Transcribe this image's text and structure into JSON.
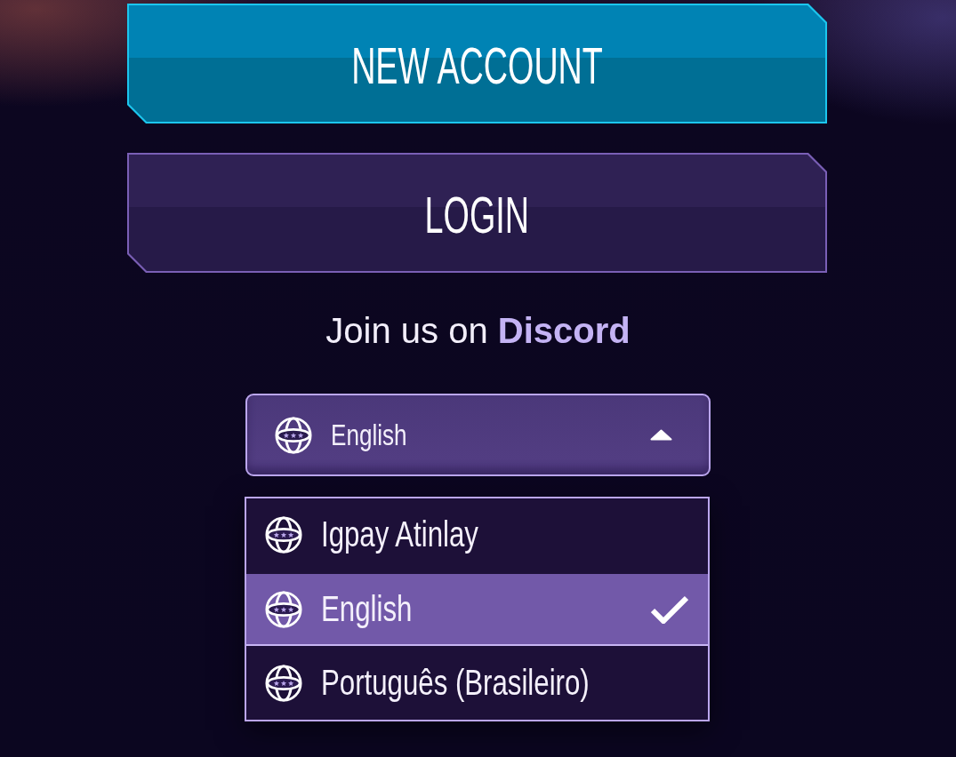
{
  "buttons": [
    {
      "label": "NEW ACCOUNT",
      "kind": "primary"
    },
    {
      "label": "LOGIN",
      "kind": "secondary"
    }
  ],
  "discord": {
    "text": "Join us on",
    "link": "Discord"
  },
  "language_select": {
    "value": "English",
    "expanded": true
  },
  "language_menu": {
    "options": [
      {
        "label": "Igpay Atinlay",
        "selected": false
      },
      {
        "label": "English",
        "selected": true
      },
      {
        "label": "Português (Brasileiro)",
        "selected": false
      }
    ]
  }
}
